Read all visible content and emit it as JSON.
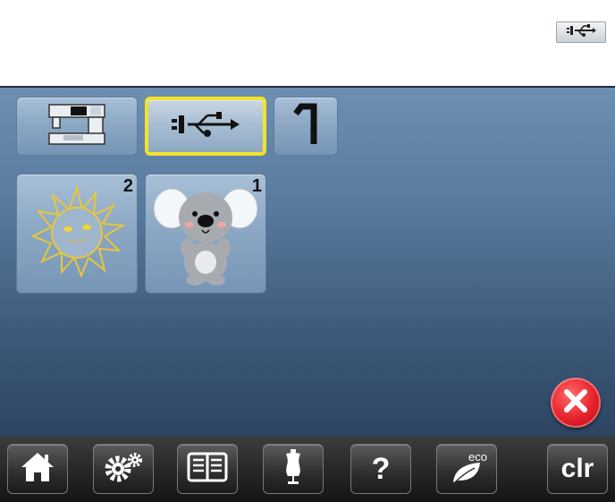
{
  "top_indicator": {
    "icon": "usb-icon"
  },
  "toolbar": {
    "items": [
      {
        "name": "machine-memory",
        "icon": "sewing-machine-icon"
      },
      {
        "name": "usb",
        "icon": "usb-icon",
        "selected": true
      },
      {
        "name": "back",
        "icon": "return-arrow-icon"
      }
    ]
  },
  "designs": [
    {
      "name": "sun",
      "icon": "sun-design-icon",
      "count": "2"
    },
    {
      "name": "koala",
      "icon": "koala-design-icon",
      "count": "1"
    }
  ],
  "close": {
    "icon": "close-icon",
    "color": "#e5202a"
  },
  "bottom_bar": {
    "items": [
      {
        "name": "home",
        "icon": "home-icon"
      },
      {
        "name": "setup",
        "icon": "gears-icon"
      },
      {
        "name": "tutorial",
        "icon": "book-icon"
      },
      {
        "name": "dress-form",
        "icon": "dress-form-icon"
      },
      {
        "name": "help",
        "label": "?"
      },
      {
        "name": "eco",
        "label": "eco",
        "icon": "leaf-icon"
      },
      {
        "name": "clear",
        "label": "clr"
      }
    ]
  },
  "colors": {
    "selected_border": "#f3e22c",
    "screen_top": "#6d8fb2",
    "screen_bottom": "#2c4460"
  }
}
